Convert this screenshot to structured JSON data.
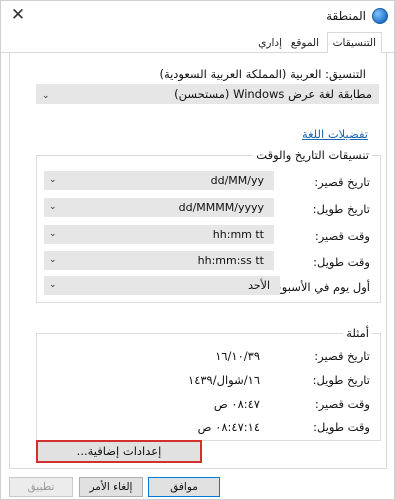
{
  "window": {
    "title": "المنطقة",
    "close_glyph": "✕"
  },
  "tabs": [
    {
      "label": "التنسيقات"
    },
    {
      "label": "الموقع"
    },
    {
      "label": "إداري"
    }
  ],
  "format": {
    "label": "التنسيق: العربية (المملكة العربية السعودية)",
    "value": "مطابقة لغة عرض Windows (مستحسن)"
  },
  "language_link": "تفضيلات اللغة",
  "date_time": {
    "title": "تنسيقات التاريخ والوقت",
    "fields": [
      {
        "label": "تاريخ قصير:",
        "value": "dd/MM/yy"
      },
      {
        "label": "تاريخ طويل:",
        "value": "dd/MMMM/yyyy"
      },
      {
        "label": "وقت قصير:",
        "value": "hh:mm tt"
      },
      {
        "label": "وقت طويل:",
        "value": "hh:mm:ss tt"
      },
      {
        "label": "أول يوم في الأسبوع:",
        "value": "الأحد"
      }
    ]
  },
  "examples": {
    "title": "أمثلة",
    "rows": [
      {
        "label": "تاريخ قصير:",
        "value": "١٦/١٠/٣٩"
      },
      {
        "label": "تاريخ طويل:",
        "value": "١٦/شوال/١٤٣٩"
      },
      {
        "label": "وقت قصير:",
        "value": "٠٨:٤٧ ص"
      },
      {
        "label": "وقت طويل:",
        "value": "٠٨:٤٧:١٤ ص"
      }
    ]
  },
  "additional_settings": "إعدادات إضافية...",
  "buttons": {
    "ok": "موافق",
    "cancel": "إلغاء الأمر",
    "apply": "تطبيق"
  },
  "colors": {
    "link": "#1a66b3",
    "highlight_border": "#d32f2f"
  }
}
